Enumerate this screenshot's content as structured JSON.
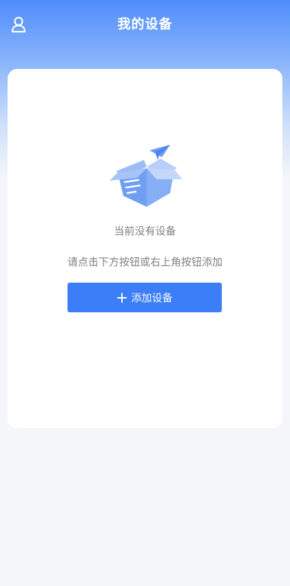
{
  "header": {
    "title": "我的设备",
    "user_icon": "user-icon"
  },
  "empty_state": {
    "illustration": "empty-box-icon",
    "title": "当前没有设备",
    "hint": "请点击下方按钮或右上角按钮添加"
  },
  "add_button": {
    "icon": "plus-icon",
    "label": "添加设备"
  },
  "colors": {
    "header_gradient_top": "#4f8dfb",
    "accent": "#3b7ef8",
    "background": "#f5f6f9",
    "muted_text": "#808080"
  }
}
